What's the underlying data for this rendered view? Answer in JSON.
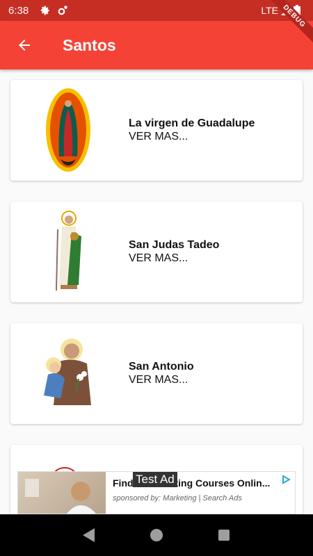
{
  "status_bar": {
    "time": "6:38",
    "network": "LTE"
  },
  "app_bar": {
    "title": "Santos"
  },
  "debug_banner": "DEBUG",
  "saints": [
    {
      "name": "La virgen de Guadalupe",
      "action": "VER MAS..."
    },
    {
      "name": "San Judas Tadeo",
      "action": "VER MAS..."
    },
    {
      "name": "San Antonio",
      "action": "VER MAS..."
    },
    {
      "name": "",
      "action": ""
    }
  ],
  "ad": {
    "badge": "Test Ad",
    "title": "Find ... Marketing Courses Onlin...",
    "sponsor": "sponsored by: Marketing | Search Ads"
  },
  "colors": {
    "app_bar": "#f44336",
    "status_bar": "#c62e24"
  }
}
